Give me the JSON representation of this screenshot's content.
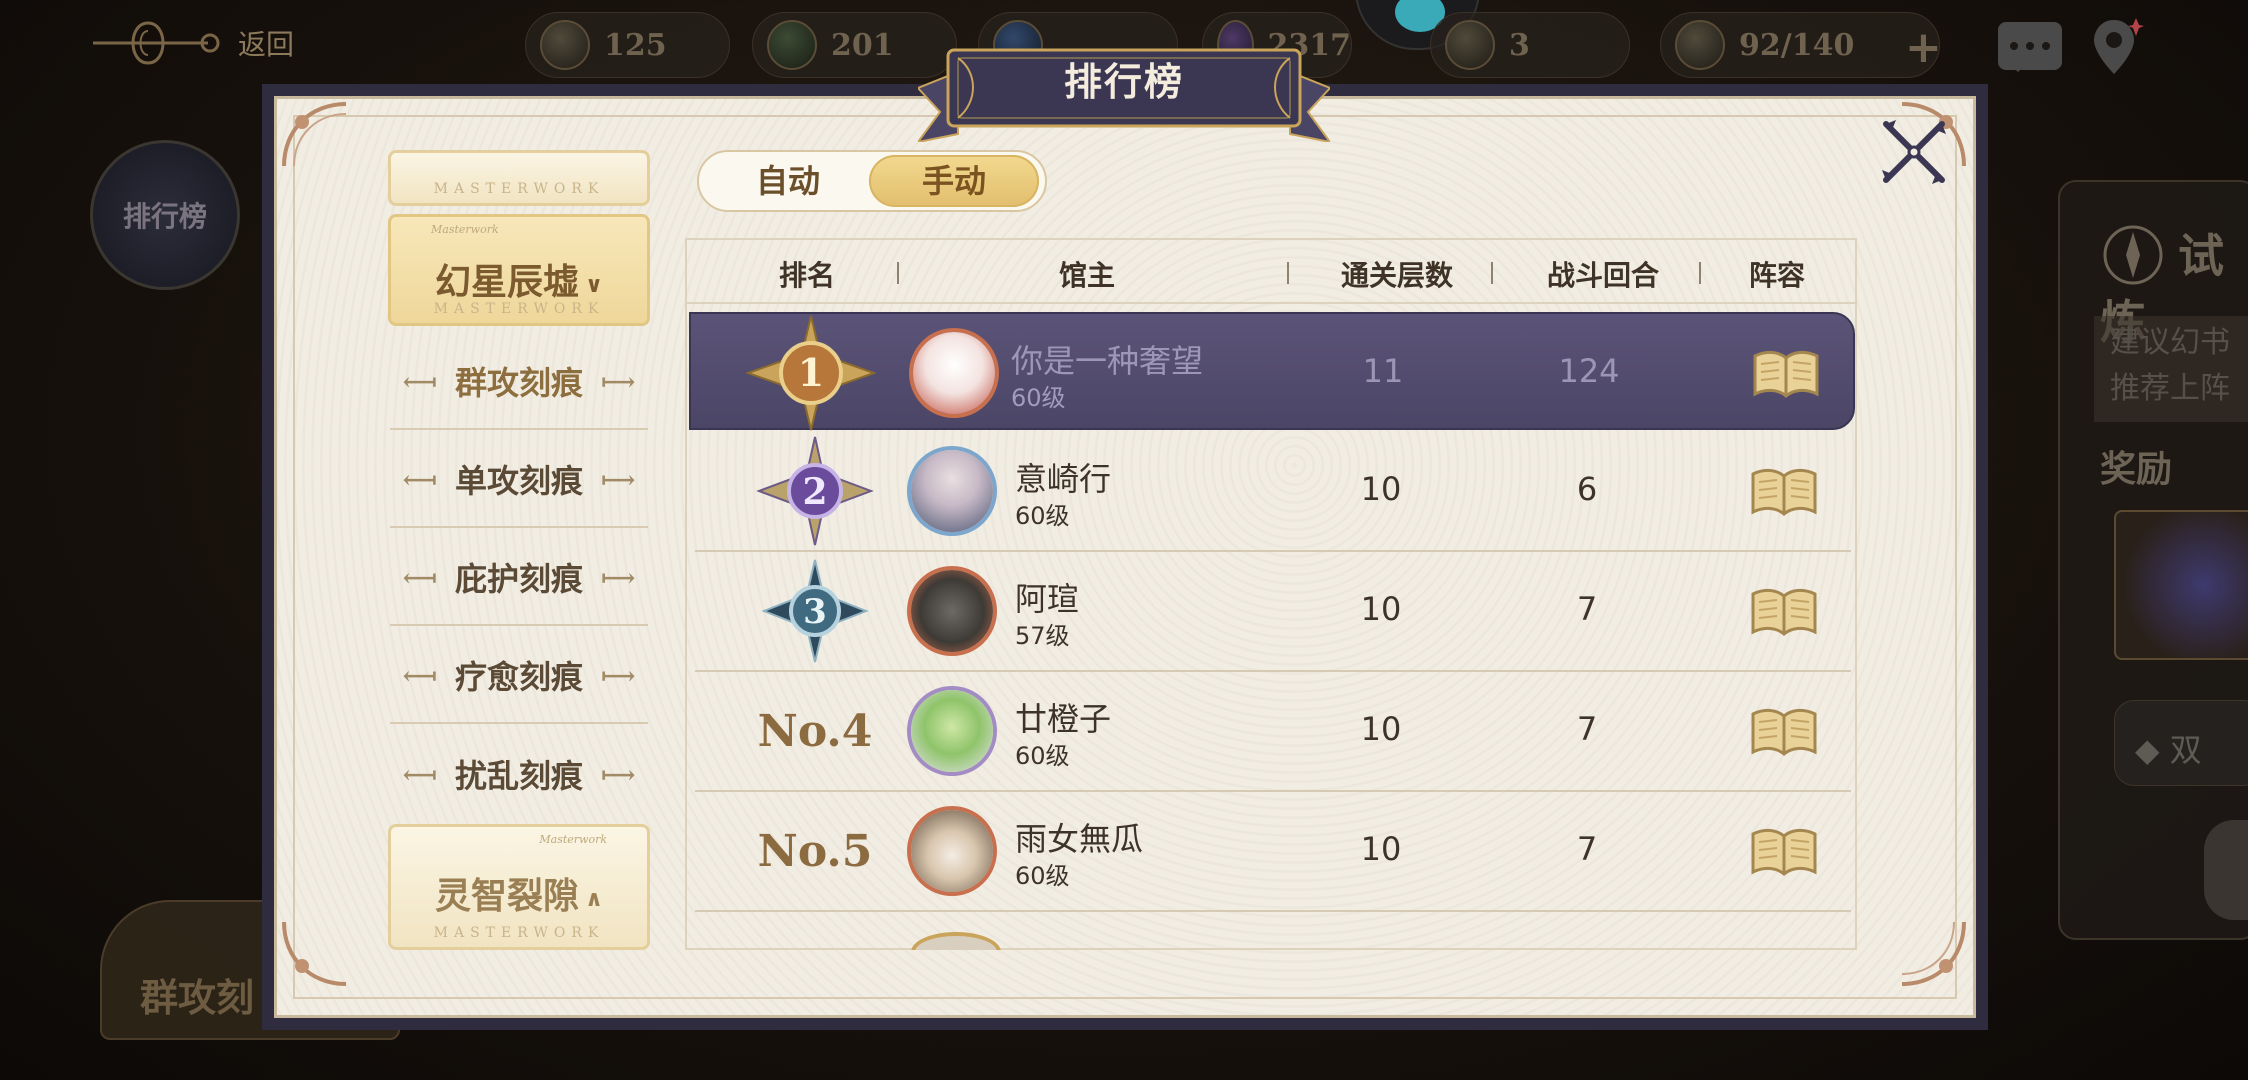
{
  "hud": {
    "back_label": "返回",
    "resources": [
      {
        "value": "125"
      },
      {
        "value": "201"
      },
      {
        "value": ""
      },
      {
        "value": "2317"
      },
      {
        "value": "3"
      },
      {
        "value": "92/140"
      }
    ],
    "plus": "+",
    "left_badge": "排行榜",
    "left_bottom": "群攻刻",
    "right_title": "试炼",
    "right_hint_line1": "建议幻书",
    "right_hint_line2": "推荐上阵",
    "right_reward": "奖励",
    "right_btn": "双"
  },
  "modal": {
    "title": "排行榜",
    "categories": {
      "peek_label": "MASTERWORK",
      "open": {
        "title": "幻星辰墟",
        "tag": "Masterwork",
        "sub": "MASTERWORK"
      },
      "items": [
        "群攻刻痕",
        "单攻刻痕",
        "庇护刻痕",
        "疗愈刻痕",
        "扰乱刻痕"
      ],
      "closed": {
        "title": "灵智裂隙",
        "tag": "Masterwork",
        "sub": "MASTERWORK"
      }
    },
    "mode": {
      "auto": "自动",
      "manual": "手动",
      "selected": "manual"
    },
    "table": {
      "headers": {
        "rank": "排名",
        "owner": "馆主",
        "floors": "通关层数",
        "rounds": "战斗回合",
        "lineup": "阵容"
      },
      "rows": [
        {
          "rank": "1",
          "name": "你是一种奢望",
          "level": "60级",
          "floors": "11",
          "rounds": "124",
          "self": true
        },
        {
          "rank": "2",
          "name": "意崎行",
          "level": "60级",
          "floors": "10",
          "rounds": "6"
        },
        {
          "rank": "3",
          "name": "阿瑄",
          "level": "57级",
          "floors": "10",
          "rounds": "7"
        },
        {
          "rank": "No.4",
          "name": "廿橙子",
          "level": "60级",
          "floors": "10",
          "rounds": "7"
        },
        {
          "rank": "No.5",
          "name": "雨女無瓜",
          "level": "60级",
          "floors": "10",
          "rounds": "7"
        }
      ]
    }
  },
  "colors": {
    "banner": "#3b3752",
    "gold": "#c9a45a",
    "highlight_row": "#514b6d",
    "paper": "#f2ede3"
  }
}
